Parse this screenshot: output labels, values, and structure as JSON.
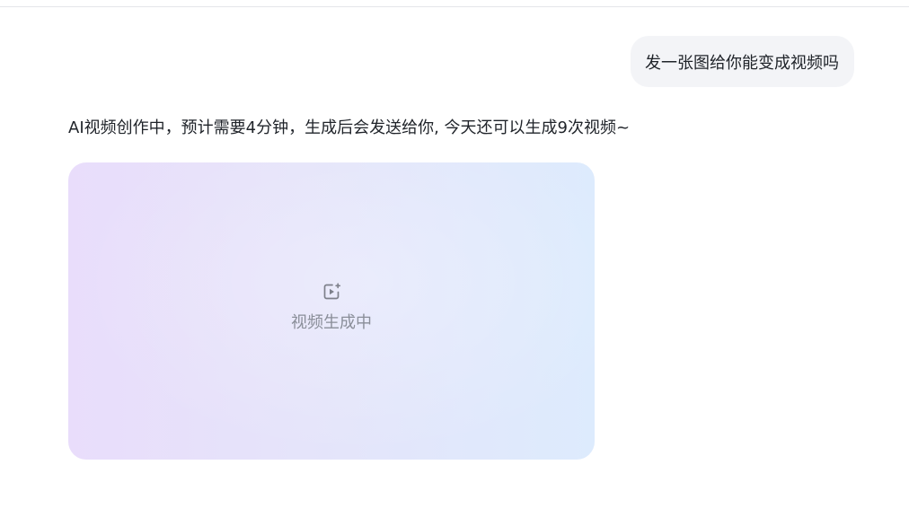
{
  "conversation": {
    "user_message": "发一张图给你能变成视频吗",
    "assistant_message": "AI视频创作中，预计需要4分钟，生成后会发送给你, 今天还可以生成9次视频~",
    "video_card": {
      "status_label": "视频生成中",
      "status_icon": "video-sparkle-icon"
    }
  },
  "colors": {
    "user_bubble_bg": "#f3f4f7",
    "card_gradient_start": "#e9ddfb",
    "card_gradient_end": "#ddebfd",
    "status_text": "#8a8e99",
    "body_text": "#1f2329"
  }
}
